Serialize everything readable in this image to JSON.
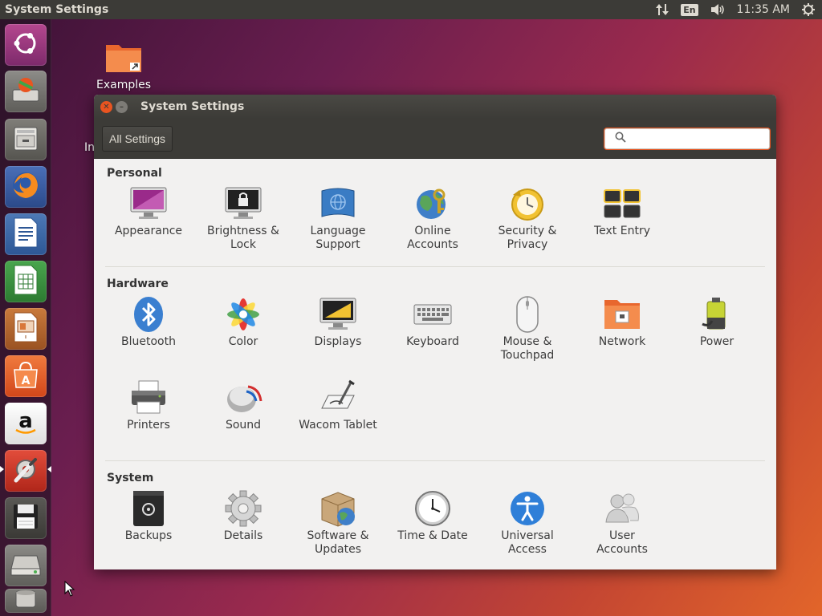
{
  "top_panel": {
    "app_title": "System Settings",
    "language": "En",
    "time": "11:35 AM"
  },
  "launcher": {
    "items": [
      {
        "name": "ubuntu-dash",
        "icon": "ubuntu-logo-icon"
      },
      {
        "name": "system-installer",
        "icon": "installer-icon"
      },
      {
        "name": "files",
        "icon": "file-cabinet-icon"
      },
      {
        "name": "firefox",
        "icon": "firefox-icon"
      },
      {
        "name": "writer",
        "icon": "writer-icon"
      },
      {
        "name": "calc",
        "icon": "calc-icon"
      },
      {
        "name": "impress",
        "icon": "impress-icon"
      },
      {
        "name": "software",
        "icon": "software-center-icon"
      },
      {
        "name": "amazon",
        "icon": "amazon-icon"
      },
      {
        "name": "system-settings",
        "icon": "settings-wrench-icon"
      },
      {
        "name": "floppy",
        "icon": "floppy-icon"
      },
      {
        "name": "drive",
        "icon": "drive-icon"
      },
      {
        "name": "trash",
        "icon": "trash-icon"
      }
    ]
  },
  "desktop": {
    "examples_label": "Examples",
    "partial_label": "In"
  },
  "window": {
    "title": "System Settings",
    "all_settings_label": "All Settings",
    "search_value": "",
    "sections": {
      "personal": {
        "title": "Personal",
        "items": [
          {
            "label": "Appearance",
            "icon": "appearance-icon"
          },
          {
            "label": "Brightness &\nLock",
            "icon": "brightness-lock-icon"
          },
          {
            "label": "Language\nSupport",
            "icon": "language-support-icon"
          },
          {
            "label": "Online\nAccounts",
            "icon": "online-accounts-icon"
          },
          {
            "label": "Security &\nPrivacy",
            "icon": "security-privacy-icon"
          },
          {
            "label": "Text Entry",
            "icon": "text-entry-icon"
          }
        ]
      },
      "hardware": {
        "title": "Hardware",
        "items": [
          {
            "label": "Bluetooth",
            "icon": "bluetooth-icon"
          },
          {
            "label": "Color",
            "icon": "color-icon"
          },
          {
            "label": "Displays",
            "icon": "displays-icon"
          },
          {
            "label": "Keyboard",
            "icon": "keyboard-icon"
          },
          {
            "label": "Mouse &\nTouchpad",
            "icon": "mouse-icon"
          },
          {
            "label": "Network",
            "icon": "network-icon"
          },
          {
            "label": "Power",
            "icon": "power-icon"
          },
          {
            "label": "Printers",
            "icon": "printer-icon"
          },
          {
            "label": "Sound",
            "icon": "sound-icon"
          },
          {
            "label": "Wacom Tablet",
            "icon": "wacom-tablet-icon"
          }
        ]
      },
      "system": {
        "title": "System",
        "items": [
          {
            "label": "Backups",
            "icon": "backups-icon"
          },
          {
            "label": "Details",
            "icon": "details-gear-icon"
          },
          {
            "label": "Software &\nUpdates",
            "icon": "software-updates-icon"
          },
          {
            "label": "Time & Date",
            "icon": "clock-icon"
          },
          {
            "label": "Universal\nAccess",
            "icon": "universal-access-icon"
          },
          {
            "label": "User\nAccounts",
            "icon": "user-accounts-icon"
          }
        ]
      }
    }
  },
  "colors": {
    "accent": "#e95420",
    "panel": "#3c3b37",
    "window_bg": "#f2f1f0"
  }
}
